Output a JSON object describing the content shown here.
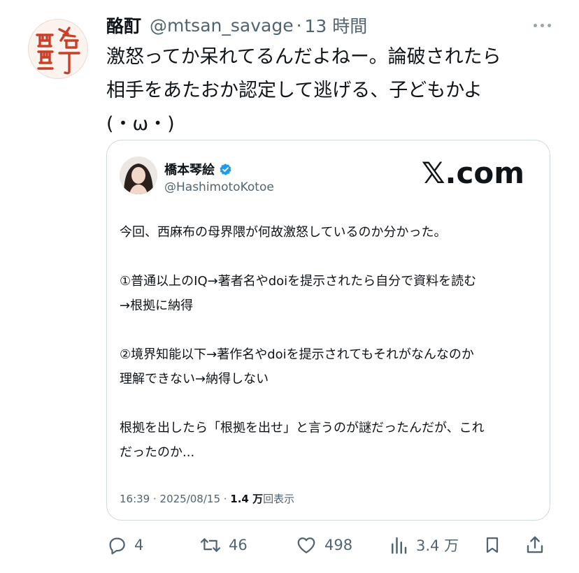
{
  "tweet": {
    "avatar_seal_text": "略酊",
    "display_name": "酪酊",
    "handle": "@mtsan_savage",
    "separator": "·",
    "time": "13 時間",
    "text": "激怒ってか呆れてるんだよねー。論破されたら\n相手をあたおか認定して逃げる、子どもかよ\n(・ω・)"
  },
  "quoted": {
    "display_name": "橋本琴絵",
    "handle": "@HashimotoKotoe",
    "brand_label": "𝕏.com",
    "text": "今回、西麻布の母界隈が何故激怒しているのか分かった。\n\n①普通以上のIQ→著者名やdoiを提示されたら自分で資料を読む\n→根拠に納得\n\n②境界知能以下→著作名やdoiを提示されてもそれがなんなのか\n理解できない→納得しない\n\n根拠を出したら「根拠を出せ」と言うのが謎だったんだが、これ\nだったのか...",
    "timestamp": "16:39 · 2025/08/15 · ",
    "views_count": "1.4 万",
    "views_label": "回表示"
  },
  "actions": {
    "replies": "4",
    "reposts": "46",
    "likes": "498",
    "views": "3.4 万"
  },
  "colors": {
    "text": "#0f1419",
    "secondary": "#536471",
    "border": "#cfd9de",
    "verified": "#1d9bf0",
    "seal": "#c8402a"
  },
  "icons": [
    "more-icon",
    "verified-icon",
    "reply-icon",
    "repost-icon",
    "like-icon",
    "views-icon",
    "bookmark-icon",
    "share-icon"
  ]
}
